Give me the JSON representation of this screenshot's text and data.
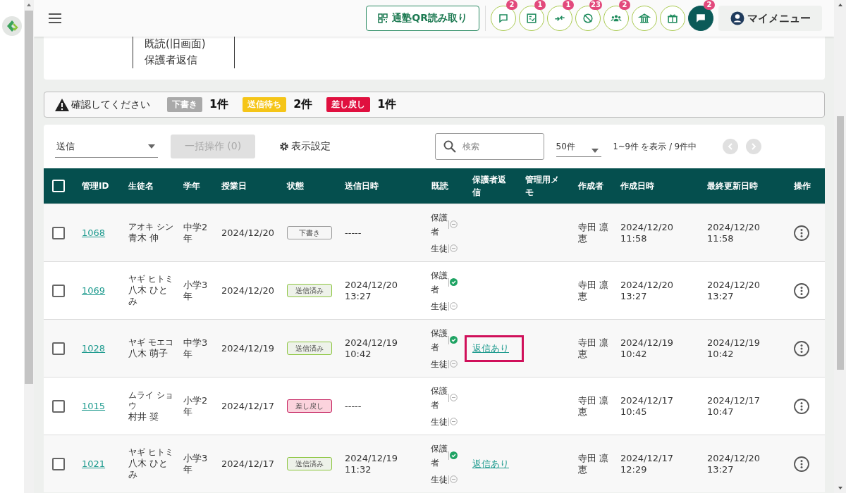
{
  "header": {
    "qr_button": "通塾QR読み取り",
    "icon_buttons": [
      {
        "kind": "chat",
        "badge": "2",
        "selected": false
      },
      {
        "kind": "checklist",
        "badge": "1",
        "selected": false
      },
      {
        "kind": "arrows",
        "badge": "1",
        "selected": false
      },
      {
        "kind": "blocked",
        "badge": "23",
        "selected": false
      },
      {
        "kind": "group",
        "badge": "2",
        "selected": false
      },
      {
        "kind": "school",
        "selected": false
      },
      {
        "kind": "gift",
        "selected": false
      },
      {
        "kind": "chat-filled",
        "badge": "2",
        "selected": true
      }
    ],
    "my_menu": "マイメニュー"
  },
  "legacy_panel": {
    "lines": [
      "既読(旧画面)",
      "保護者返信"
    ]
  },
  "alert": {
    "message": "確認してください",
    "counts": [
      {
        "label": "下書き",
        "count": "1件",
        "color": "#a9a9a9"
      },
      {
        "label": "送信待ち",
        "count": "2件",
        "color": "#f5c518"
      },
      {
        "label": "差し戻し",
        "count": "1件",
        "color": "#e0103f"
      }
    ]
  },
  "toolbar": {
    "filter": "送信",
    "bulk_button": {
      "label": "一括操作 (0)",
      "disabled": true
    },
    "display_settings": "表示設定",
    "search": {
      "placeholder": "検索"
    },
    "per_page": "50件",
    "range": "1~9件 を表示 / 9件中",
    "prev": {
      "disabled": true
    },
    "next": {
      "disabled": true
    }
  },
  "table": {
    "select_all": {
      "checked": false
    },
    "columns": [
      "管理ID",
      "生徒名",
      "学年",
      "授業日",
      "状態",
      "送信日時",
      "既読",
      "保護者返信",
      "管理用メモ",
      "作成者",
      "作成日時",
      "最終更新日時",
      "操作"
    ],
    "rows": [
      {
        "checked": false,
        "id": "1068",
        "kana": "アオキ シン",
        "name": "青木 伸",
        "grade": "中学2年",
        "lesson_date": "2024/12/20",
        "status": {
          "kind": "draft",
          "label": "下書き"
        },
        "sent_at": "-----",
        "read": [
          {
            "label": "保護者",
            "read": false
          },
          {
            "label": "生徒",
            "read": false
          }
        ],
        "creator": "寺田 凛恵",
        "created_at": "2024/12/20 11:58",
        "updated_at": "2024/12/20 11:58"
      },
      {
        "checked": false,
        "id": "1069",
        "kana": "ヤギ ヒトミ",
        "name": "八木 ひとみ",
        "grade": "小学3年",
        "lesson_date": "2024/12/20",
        "status": {
          "kind": "sent",
          "label": "送信済み"
        },
        "sent_at": "2024/12/20 13:27",
        "read": [
          {
            "label": "保護者",
            "read": true
          },
          {
            "label": "生徒",
            "read": false
          }
        ],
        "creator": "寺田 凛恵",
        "created_at": "2024/12/20 13:27",
        "updated_at": "2024/12/20 13:27"
      },
      {
        "checked": false,
        "id": "1028",
        "kana": "ヤギ モエコ",
        "name": "八木 萌子",
        "grade": "中学3年",
        "lesson_date": "2024/12/19",
        "status": {
          "kind": "sent",
          "label": "送信済み"
        },
        "sent_at": "2024/12/19 10:42",
        "read": [
          {
            "label": "保護者",
            "read": true
          },
          {
            "label": "生徒",
            "read": false
          }
        ],
        "reply": {
          "label": "返信あり",
          "highlighted": true
        },
        "creator": "寺田 凛恵",
        "created_at": "2024/12/19 10:42",
        "updated_at": "2024/12/19 10:42"
      },
      {
        "checked": false,
        "id": "1015",
        "kana": "ムライ ショウ",
        "name": "村井 奨",
        "grade": "小学2年",
        "lesson_date": "2024/12/17",
        "status": {
          "kind": "returned",
          "label": "差し戻し"
        },
        "sent_at": "-----",
        "read": [
          {
            "label": "保護者",
            "read": false
          },
          {
            "label": "生徒",
            "read": false
          }
        ],
        "creator": "寺田 凛恵",
        "created_at": "2024/12/17 10:45",
        "updated_at": "2024/12/17 10:47"
      },
      {
        "checked": false,
        "id": "1021",
        "kana": "ヤギ ヒトミ",
        "name": "八木 ひとみ",
        "grade": "小学3年",
        "lesson_date": "2024/12/17",
        "status": {
          "kind": "sent",
          "label": "送信済み"
        },
        "sent_at": "2024/12/19 11:32",
        "read": [
          {
            "label": "保護者",
            "read": true
          },
          {
            "label": "生徒",
            "read": false
          }
        ],
        "reply": {
          "label": "返信あり",
          "highlighted": false
        },
        "creator": "寺田 凛恵",
        "created_at": "2024/12/17 12:29",
        "updated_at": "2024/12/20 13:27"
      }
    ]
  }
}
